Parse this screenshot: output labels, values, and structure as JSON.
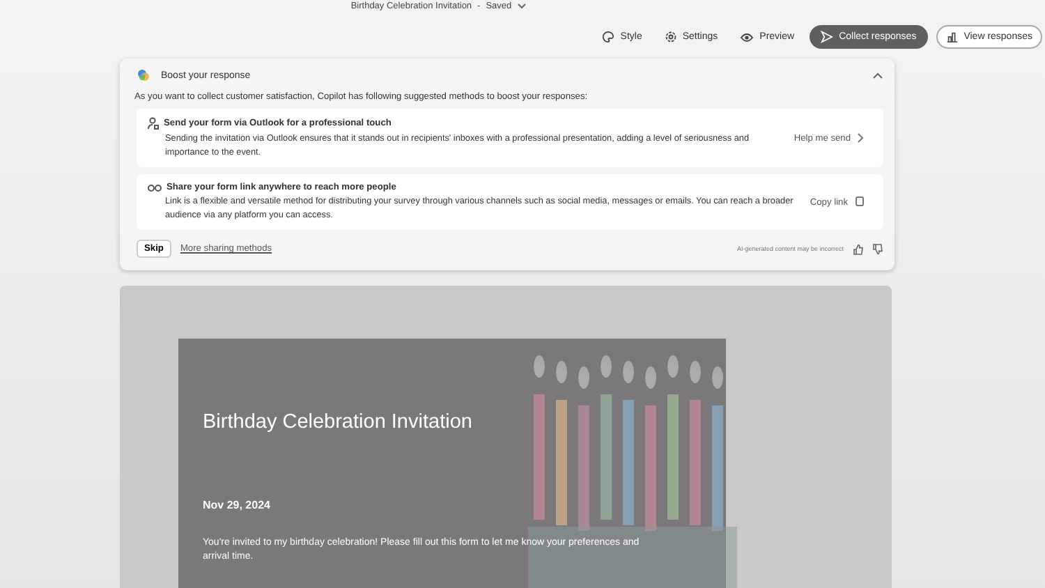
{
  "header": {
    "title": "Birthday Celebration Invitation",
    "separator": "-",
    "status": "Saved"
  },
  "toolbar": [
    {
      "kind": "style",
      "label": "Style"
    },
    {
      "kind": "settings",
      "label": "Settings"
    },
    {
      "kind": "preview",
      "label": "Preview"
    },
    {
      "kind": "collect",
      "label": "Collect responses"
    },
    {
      "kind": "view",
      "label": "View responses"
    }
  ],
  "boost": {
    "title": "Boost your response",
    "expanded": true,
    "intro": "As you want to collect customer satisfaction, Copilot has following suggested methods to boost your responses:",
    "suggestions": [
      {
        "kind": "outlook",
        "title": "Send your form via Outlook for a professional touch",
        "text": "Sending the invitation via Outlook ensures that it stands out in recipients' inboxes with a professional presentation, adding a level of seriousness and importance to the event.",
        "action": "Help me send"
      },
      {
        "kind": "link",
        "title": "Share your form link anywhere to reach more people",
        "text": "Link is a flexible and versatile method for distributing your survey through various channels such as social media, messages or emails. You can reach a broader audience via any platform you can access.",
        "action": "Copy link"
      }
    ],
    "skip": "Skip",
    "more": "More sharing methods",
    "disclaimer": "AI-generated content may be incorrect"
  },
  "form": {
    "title": "Birthday Celebration Invitation",
    "date": "Nov 29, 2024",
    "description": "You're invited to my birthday celebration! Please fill out this form to let me know your preferences and arrival time."
  }
}
